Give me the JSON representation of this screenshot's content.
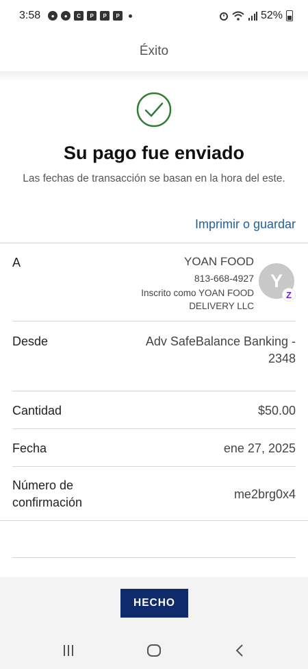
{
  "status_bar": {
    "time": "3:58",
    "battery": "52%"
  },
  "header": {
    "title": "Éxito"
  },
  "success": {
    "title": "Su pago fue enviado",
    "subtitle": "Las fechas de transacción se basan en la hora del este.",
    "print_link": "Imprimir o guardar",
    "check_color": "#2e7d32"
  },
  "details": {
    "to": {
      "label": "A",
      "name": "YOAN FOOD",
      "phone": "813-668-4927",
      "enrolled": "Inscrito como YOAN FOOD DELIVERY LLC",
      "avatar_initial": "Y",
      "badge": "Z"
    },
    "from": {
      "label": "Desde",
      "line1": "Adv SafeBalance Banking -",
      "line2": "2348"
    },
    "amount": {
      "label": "Cantidad",
      "value": "$50.00"
    },
    "date": {
      "label": "Fecha",
      "value": "ene 27, 2025"
    },
    "confirmation": {
      "label_line1": "Número de",
      "label_line2": "confirmación",
      "value": "me2brg0x4"
    }
  },
  "footer": {
    "done_label": "HECHO",
    "accent": "#0f2b6c"
  }
}
